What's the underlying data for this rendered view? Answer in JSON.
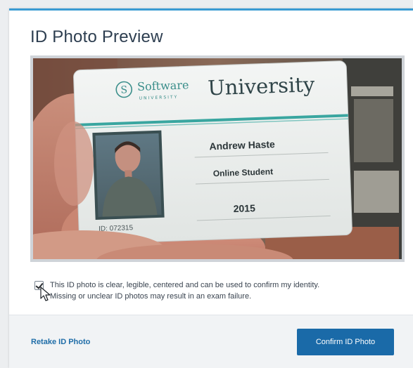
{
  "dialog": {
    "title": "ID Photo Preview"
  },
  "id_card": {
    "logo_text": "Software",
    "logo_sub": "UNIVERSITY",
    "university": "University",
    "name": "Andrew Haste",
    "role": "Online Student",
    "year": "2015",
    "id_label": "ID: 072315"
  },
  "consent": {
    "checked": true,
    "line1": "This ID photo is clear, legible, centered and can be used to confirm my identity.",
    "line2": "Missing or unclear ID photos may result in an exam failure."
  },
  "footer": {
    "retake_label": "Retake ID Photo",
    "confirm_label": "Confirm ID Photo"
  },
  "colors": {
    "accent": "#3b9bd3",
    "primary_button": "#1a6aa8",
    "link": "#1f6da8",
    "card_stripe": "#3aa6a0"
  }
}
